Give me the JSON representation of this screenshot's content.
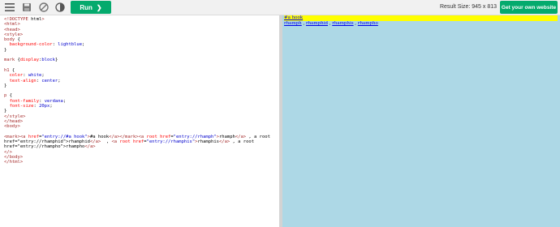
{
  "toolbar": {
    "icons": [
      "menu-icon",
      "save-icon",
      "orientation-icon",
      "theme-icon"
    ],
    "run_label": "Run",
    "run_chevron": "❯",
    "result_size": "Result Size: 945 x 813",
    "get_site_label": "Get your own website",
    "accent_color": "#04aa6d"
  },
  "editor": {
    "lines": [
      "<!DOCTYPE html>",
      "<html>",
      "<head>",
      "<style>",
      "body {",
      "  background-color: lightblue;",
      "}",
      "",
      "mark {display:block}",
      "",
      "h1 {",
      "  color: white;",
      "  text-align: center;",
      "}",
      "",
      "p {",
      "  font-family: verdana;",
      "  font-size: 20px;",
      "}",
      "</style>",
      "</head>",
      "<body>",
      "",
      "<mark><a href=\"entry://#a hook\">#a hook</a></mark><a root href=\"entry://rhamph\">rhamph</a> , <a root",
      "href=\"entry://rhamphid\">rhamphid</a>  , <a root href=\"entry://rhamphis\">rhamphis</a> , <a root",
      "href=\"entry://rhampho\">rhampho</a>",
      "</>",
      "</body>",
      "</html>"
    ]
  },
  "result": {
    "background": "#add8e6",
    "mark_link": "#a hook",
    "links": [
      "rhamph",
      "rhamphid",
      "rhamphis",
      "rhampho"
    ],
    "separator": " , "
  }
}
